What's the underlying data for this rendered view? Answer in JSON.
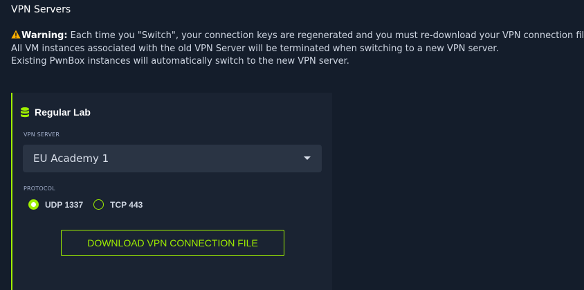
{
  "page": {
    "title": "VPN Servers"
  },
  "warning": {
    "icon": "warning-triangle-icon",
    "label": "Warning:",
    "line1": "Each time you \"Switch\", your connection keys are regenerated and you must re-download your VPN connection file.",
    "line2": "All VM instances associated with the old VPN Server will be terminated when switching to a new VPN server.",
    "line3": "Existing PwnBox instances will automatically switch to the new VPN server."
  },
  "card": {
    "icon": "database-icon",
    "title": "Regular Lab",
    "server_label": "VPN SERVER",
    "server_value": "EU Academy 1",
    "protocol_label": "PROTOCOL",
    "protocols": [
      {
        "label": "UDP 1337",
        "selected": true
      },
      {
        "label": "TCP 443",
        "selected": false
      }
    ],
    "download_label": "DOWNLOAD VPN CONNECTION FILE"
  },
  "colors": {
    "background": "#141d2b",
    "card": "#1a2332",
    "accent": "#9fef00",
    "warning": "#ffaf00"
  }
}
